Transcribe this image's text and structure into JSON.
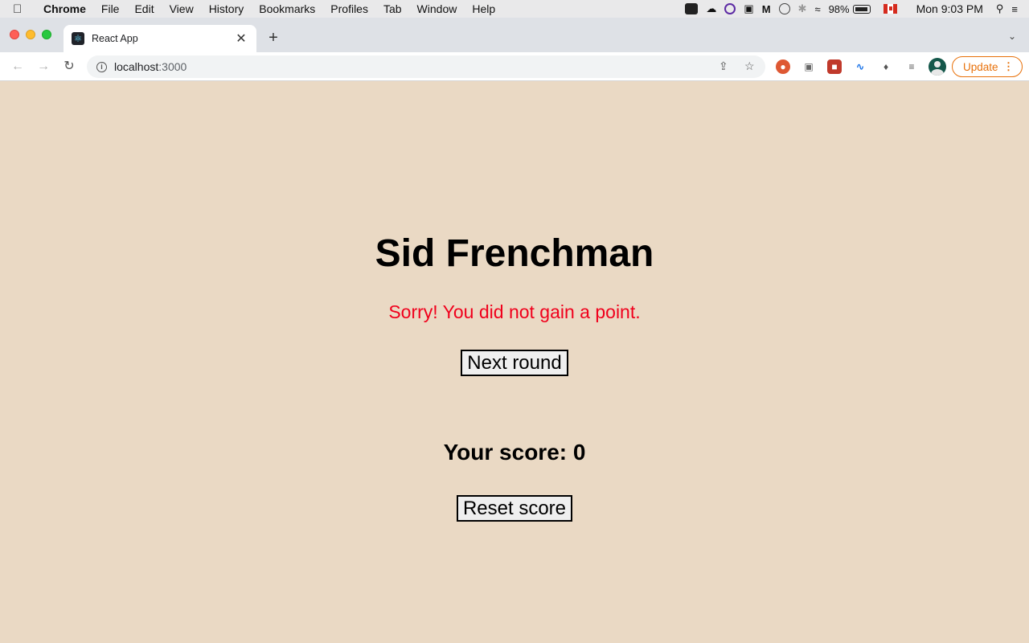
{
  "menubar": {
    "apple_icon": "apple-icon",
    "app_name": "Chrome",
    "items": [
      "File",
      "Edit",
      "View",
      "History",
      "Bookmarks",
      "Profiles",
      "Tab",
      "Window",
      "Help"
    ],
    "battery": "98%",
    "clock": "Mon 9:03 PM"
  },
  "browser": {
    "tab_title": "React App",
    "url_host": "localhost",
    "url_port": ":3000",
    "update_label": "Update"
  },
  "game": {
    "player_name": "Sid Frenchman",
    "message": "Sorry! You did not gain a point.",
    "message_color": "#f0001c",
    "next_round_label": "Next round",
    "score_text": "Your score: 0",
    "reset_label": "Reset score"
  },
  "colors": {
    "page_background": "#ead9c4",
    "update_accent": "#e8710a"
  }
}
